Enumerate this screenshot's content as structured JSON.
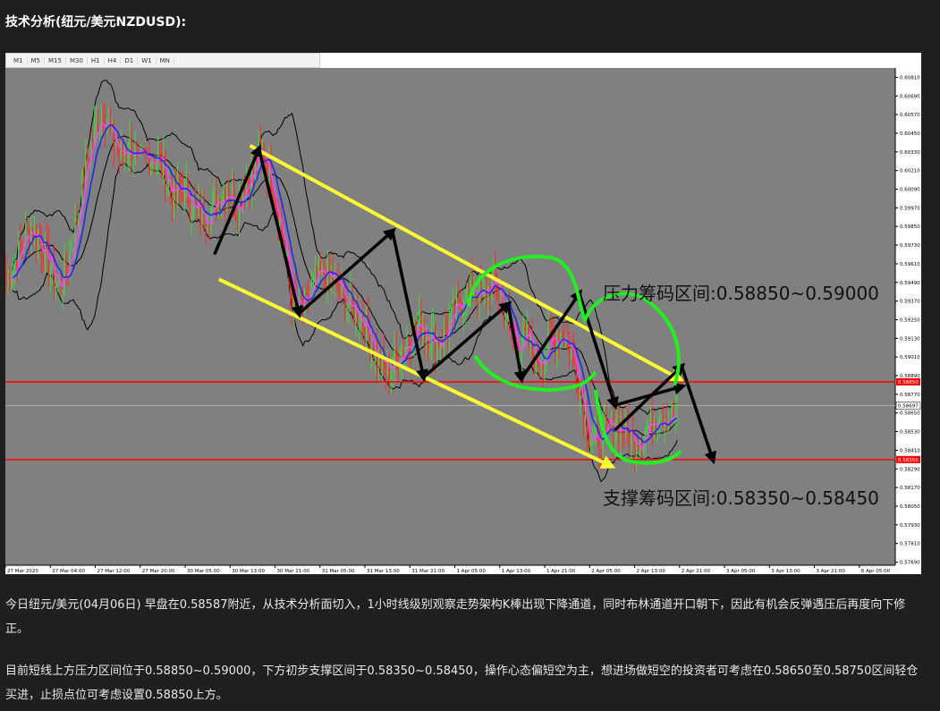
{
  "heading": "技术分析(纽元/美元NZDUSD):",
  "timeframes": [
    "M1",
    "M5",
    "M15",
    "M30",
    "H1",
    "H4",
    "D1",
    "W1",
    "MN"
  ],
  "chart_data": {
    "type": "candlestick",
    "symbol": "NZDUSD",
    "timeframe": "H1",
    "ylim": [
      0.5767,
      0.6087
    ],
    "y_ticks": [
      "0.60810",
      "0.60690",
      "0.60570",
      "0.60450",
      "0.60330",
      "0.60210",
      "0.60090",
      "0.59970",
      "0.59850",
      "0.59730",
      "0.59610",
      "0.59490",
      "0.59370",
      "0.59250",
      "0.59130",
      "0.59010",
      "0.58890",
      "0.58770",
      "0.58650",
      "0.58530",
      "0.58410",
      "0.58290",
      "0.58170",
      "0.58050",
      "0.57930",
      "0.57810",
      "0.57690"
    ],
    "x_ticks": [
      "27 Mar 2020",
      "27 Mar 04:00",
      "27 Mar 12:00",
      "27 Mar 20:00",
      "30 Mar 05:00",
      "30 Mar 13:00",
      "30 Mar 21:00",
      "31 Mar 05:00",
      "31 Mar 13:00",
      "31 Mar 21:00",
      "1 Apr 05:00",
      "1 Apr 13:00",
      "1 Apr 21:00",
      "2 Apr 05:00",
      "2 Apr 13:00",
      "2 Apr 21:00",
      "3 Apr 05:00",
      "3 Apr 13:00",
      "3 Apr 21:00",
      "6 Apr 05:00"
    ],
    "current_price": "0.58697",
    "red_lines": [
      {
        "price": 0.5885,
        "label": "0.58850"
      },
      {
        "price": 0.5835,
        "label": "0.58350"
      }
    ],
    "resistance_label": "压力筹码区间:0.58850~0.59000",
    "support_label": "支撑筹码区间:0.58350~0.58450",
    "close_path": [
      0.595,
      0.5962,
      0.5978,
      0.5985,
      0.5972,
      0.5958,
      0.5945,
      0.5962,
      0.599,
      0.6025,
      0.6045,
      0.6062,
      0.604,
      0.603,
      0.6038,
      0.6022,
      0.603,
      0.6032,
      0.6018,
      0.6005,
      0.601,
      0.6,
      0.5992,
      0.5995,
      0.6002,
      0.6012,
      0.5998,
      0.6015,
      0.6022,
      0.6035,
      0.6015,
      0.5988,
      0.595,
      0.5928,
      0.5935,
      0.5948,
      0.5955,
      0.595,
      0.5942,
      0.5932,
      0.593,
      0.5918,
      0.5902,
      0.5892,
      0.5898,
      0.5908,
      0.5918,
      0.5922,
      0.5915,
      0.5912,
      0.592,
      0.593,
      0.5942,
      0.5945,
      0.5938,
      0.595,
      0.594,
      0.592,
      0.5908,
      0.5912,
      0.5898,
      0.5905,
      0.5912,
      0.5918,
      0.5905,
      0.5882,
      0.5852,
      0.5845,
      0.5852,
      0.5858,
      0.5855,
      0.5848,
      0.5852,
      0.5858,
      0.5868,
      0.5862,
      0.5866
    ],
    "bollinger_period": 20,
    "ma_periods": [
      5,
      10
    ],
    "channel": {
      "upper": [
        [
          0.5,
          0.6037
        ],
        [
          0.65,
          0.5885
        ]
      ],
      "lower": [
        [
          0.5,
          0.5951
        ],
        [
          0.65,
          0.5797
        ]
      ]
    },
    "zigzag": [
      0.5967,
      0.6035,
      0.5929,
      0.5982,
      0.5888,
      0.5935,
      0.5887,
      0.5942,
      0.587,
      0.5882,
      0.5854,
      0.5895,
      0.5835
    ],
    "resistance_zone_outline": "green",
    "support_zone_outline": "green"
  },
  "paragraphs": [
    "今日纽元/美元(04月06日) 早盘在0.58587附近，从技术分析面切入，1小时线级别观察走势架构K棒出现下降通道，同时布林通道开口朝下，因此有机会反弹遇压后再度向下修正。",
    "目前短线上方压力区间位于0.58850~0.59000，下方初步支撑区间于0.58350~0.58450，操作心态偏短空为主，想进场做短空的投资者可考虑在0.58650至0.58750区间轻仓买进，止损点位可考虑设置0.58850上方。"
  ],
  "colors": {
    "bull": "#45d445",
    "bear": "#ff2a2a",
    "ma_fast": "#ff40ff",
    "ma_slow": "#1e2ce8",
    "bollinger": "#000000",
    "channel": "#ffff33",
    "zigzag": "#000000",
    "zone": "#22ee22",
    "red_line": "#ff0000",
    "plot_bg": "#808080"
  }
}
